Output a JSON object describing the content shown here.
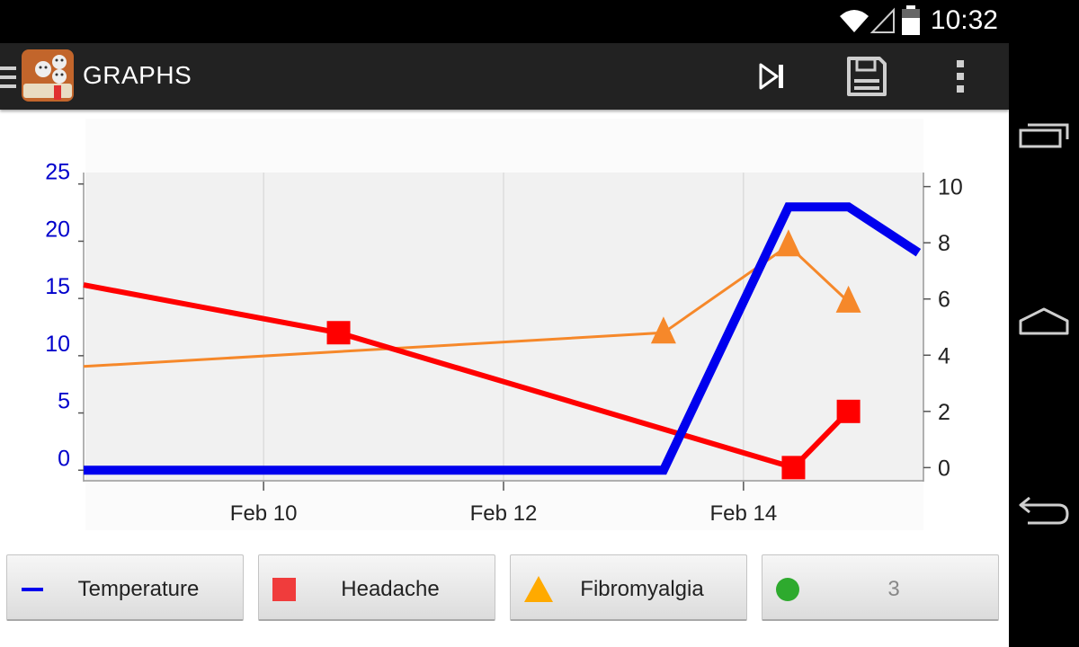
{
  "status": {
    "time": "10:32"
  },
  "toolbar": {
    "title": "GRAPHS",
    "actions": [
      {
        "name": "skip-next-icon"
      },
      {
        "name": "save-icon"
      },
      {
        "name": "overflow-menu-icon"
      }
    ]
  },
  "legend": {
    "items": [
      {
        "label": "Temperature",
        "marker": "line",
        "color": "#0000ee"
      },
      {
        "label": "Headache",
        "marker": "square",
        "color": "#f03c3c"
      },
      {
        "label": "Fibromyalgia",
        "marker": "triangle",
        "color": "#ffaa00"
      },
      {
        "label": "3",
        "marker": "circle",
        "color": "#2eaa2e"
      }
    ]
  },
  "colors": {
    "temperature": "#0000ee",
    "headache": "#ff0000",
    "fibromyalgia": "#f6882a",
    "left_axis": "#0000cc"
  },
  "chart_data": {
    "type": "line",
    "x_type": "date",
    "x_ticks": [
      "Feb 10",
      "Feb 12",
      "Feb 14"
    ],
    "xlim": [
      "2014-02-08 12:00",
      "2014-02-15 12:00"
    ],
    "left_axis": {
      "ticks": [
        "0",
        "5",
        "10",
        "15",
        "20",
        "25"
      ],
      "ylim": [
        -1,
        26
      ]
    },
    "right_axis": {
      "ticks": [
        "0",
        "2",
        "4",
        "6",
        "8",
        "10"
      ],
      "ylim": [
        -0.5,
        10.5
      ]
    },
    "grid": true,
    "series": [
      {
        "name": "Temperature",
        "axis": "left",
        "marker": "none",
        "x": [
          "2014-02-08 12:00",
          "2014-02-13 08:00",
          "2014-02-14 09:00",
          "2014-02-14 21:00",
          "2014-02-15 11:00"
        ],
        "y": [
          0,
          0,
          23,
          23,
          19
        ]
      },
      {
        "name": "Headache",
        "axis": "right",
        "marker": "square",
        "x": [
          "2014-02-08 12:00",
          "2014-02-10 15:00",
          "2014-02-14 10:00",
          "2014-02-14 21:00"
        ],
        "y": [
          6.5,
          4.8,
          0,
          2
        ]
      },
      {
        "name": "Fibromyalgia",
        "axis": "right",
        "marker": "triangle",
        "x": [
          "2014-02-08 12:00",
          "2014-02-13 08:00",
          "2014-02-14 09:00",
          "2014-02-14 21:00"
        ],
        "y": [
          3.6,
          4.8,
          7.9,
          5.9
        ]
      }
    ]
  }
}
